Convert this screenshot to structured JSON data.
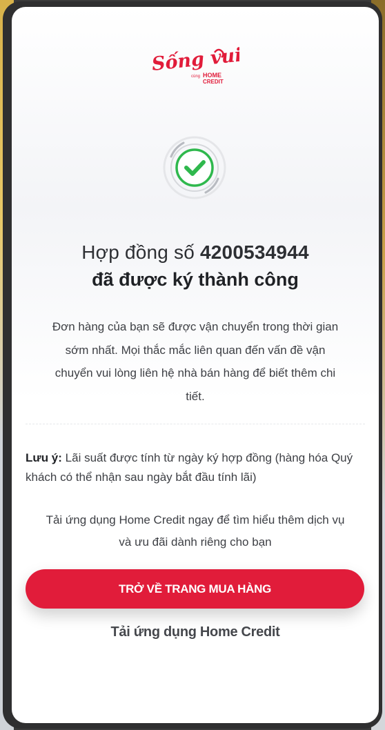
{
  "brand": {
    "logo_script": "Sống vui",
    "logo_small": "cùng",
    "logo_home": "HOME",
    "logo_credit": "CREDIT",
    "brand_color": "#e11c3a"
  },
  "status": {
    "icon": "check-circle-icon",
    "color": "#2fb84d"
  },
  "title": {
    "prefix": "Hợp đồng số",
    "contract_number": "4200534944",
    "line2": "đã được ký thành công"
  },
  "description": "Đơn hàng của bạn sẽ được vận chuyển trong thời gian sớm nhất. Mọi thắc mắc liên quan đến vấn đề vận chuyển vui lòng liên hệ nhà bán hàng để biết thêm chi tiết.",
  "note": {
    "label": "Lưu ý:",
    "text": "Lãi suất được tính từ ngày ký hợp đồng (hàng hóa Quý khách có thể nhận sau ngày bắt đầu tính lãi)"
  },
  "promo": "Tải ứng dụng Home Credit ngay để tìm hiểu thêm dịch vụ và ưu đãi dành riêng cho bạn",
  "actions": {
    "primary_label": "TRỞ VỀ TRANG MUA HÀNG",
    "secondary_label": "Tải ứng dụng Home Credit"
  }
}
